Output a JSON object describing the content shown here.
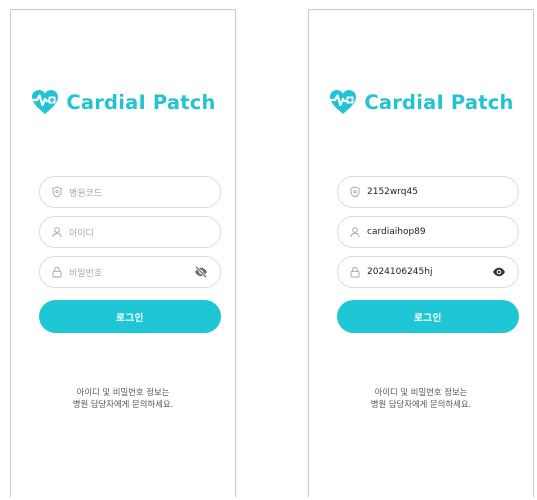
{
  "app": {
    "logo_text": "CardiaI Patch"
  },
  "colors": {
    "brand": "#22c3d3",
    "button": "#1fc7d6"
  },
  "login_empty": {
    "hospital_code_placeholder": "병원코드",
    "user_id_placeholder": "아이디",
    "password_placeholder": "비밀번호",
    "password_visibility_icon": "eye-off-icon",
    "login_button": "로그인",
    "notice_line1": "아이디 및 비밀번호 정보는",
    "notice_line2": "병원 담당자에게 문의하세요."
  },
  "login_filled": {
    "hospital_code_value": "2152wrq45",
    "user_id_value": "cardiaihop89",
    "password_value": "2024106245hj",
    "password_visibility_icon": "eye-icon",
    "login_button": "로그인",
    "notice_line1": "아이디 및 비밀번호 정보는",
    "notice_line2": "병원 담당자에게 문의하세요."
  }
}
